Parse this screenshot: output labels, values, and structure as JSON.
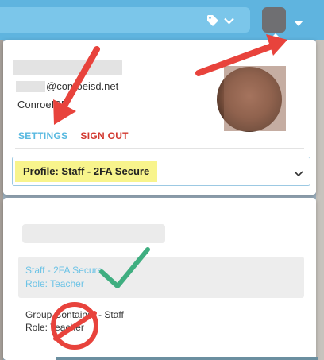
{
  "header": {
    "tag_icon": "tag-icon",
    "dropdown_icon": "chevron-down-icon",
    "avatar_caret_icon": "caret-down-icon"
  },
  "account": {
    "email_suffix": "@conroeisd.net",
    "district": "ConroeISD",
    "settings_label": "SETTINGS",
    "signout_label": "SIGN OUT"
  },
  "profile_select": {
    "selected": "Profile: Staff - 2FA Secure"
  },
  "profile_options": [
    {
      "line1": "Staff - 2FA Secure",
      "line2": "Role: Teacher",
      "active": true
    },
    {
      "line1": "Group Container - Staff",
      "line2": "Role: Teacher",
      "active": false
    }
  ],
  "colors": {
    "topbar": "#5fb4df",
    "link_blue": "#58b9e0",
    "signout_red": "#d2382f",
    "highlight_yellow": "#f8f48c",
    "arrow_red": "#e8433c",
    "check_green": "#3fae80"
  }
}
